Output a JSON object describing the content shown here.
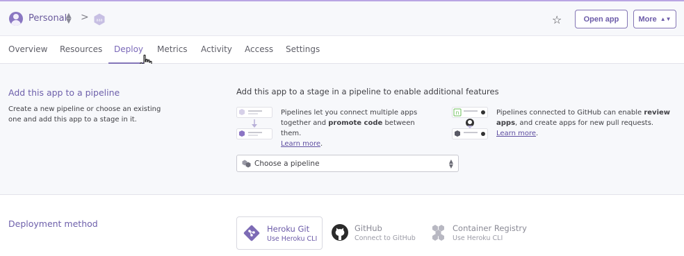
{
  "header": {
    "team_name": "Personal",
    "breadcrumb_separator": ">",
    "open_app_label": "Open app",
    "more_label": "More"
  },
  "tabs": [
    "Overview",
    "Resources",
    "Deploy",
    "Metrics",
    "Activity",
    "Access",
    "Settings"
  ],
  "active_tab": "Deploy",
  "pipeline": {
    "title": "Add this app to a pipeline",
    "description": "Create a new pipeline or choose an existing one and add this app to a stage in it.",
    "heading": "Add this app to a stage in a pipeline to enable additional features",
    "feature1": {
      "text_before": "Pipelines let you connect multiple apps together and ",
      "bold": "promote code",
      "text_after": " between them.",
      "link": "Learn more"
    },
    "feature2": {
      "text_before": "Pipelines connected to GitHub can enable ",
      "bold": "review apps",
      "text_after": ", and create apps for new pull requests.",
      "link": "Learn more"
    },
    "select_value": "Choose a pipeline"
  },
  "deployment": {
    "title": "Deployment method",
    "methods": [
      {
        "name": "Heroku Git",
        "sub": "Use Heroku CLI",
        "icon": "git-icon"
      },
      {
        "name": "GitHub",
        "sub": "Connect to GitHub",
        "icon": "github-icon"
      },
      {
        "name": "Container Registry",
        "sub": "Use Heroku CLI",
        "icon": "container-registry-icon"
      }
    ]
  },
  "colors": {
    "accent": "#7a68b8",
    "link": "#5d4da0",
    "section_bg": "#f7f8fb"
  }
}
